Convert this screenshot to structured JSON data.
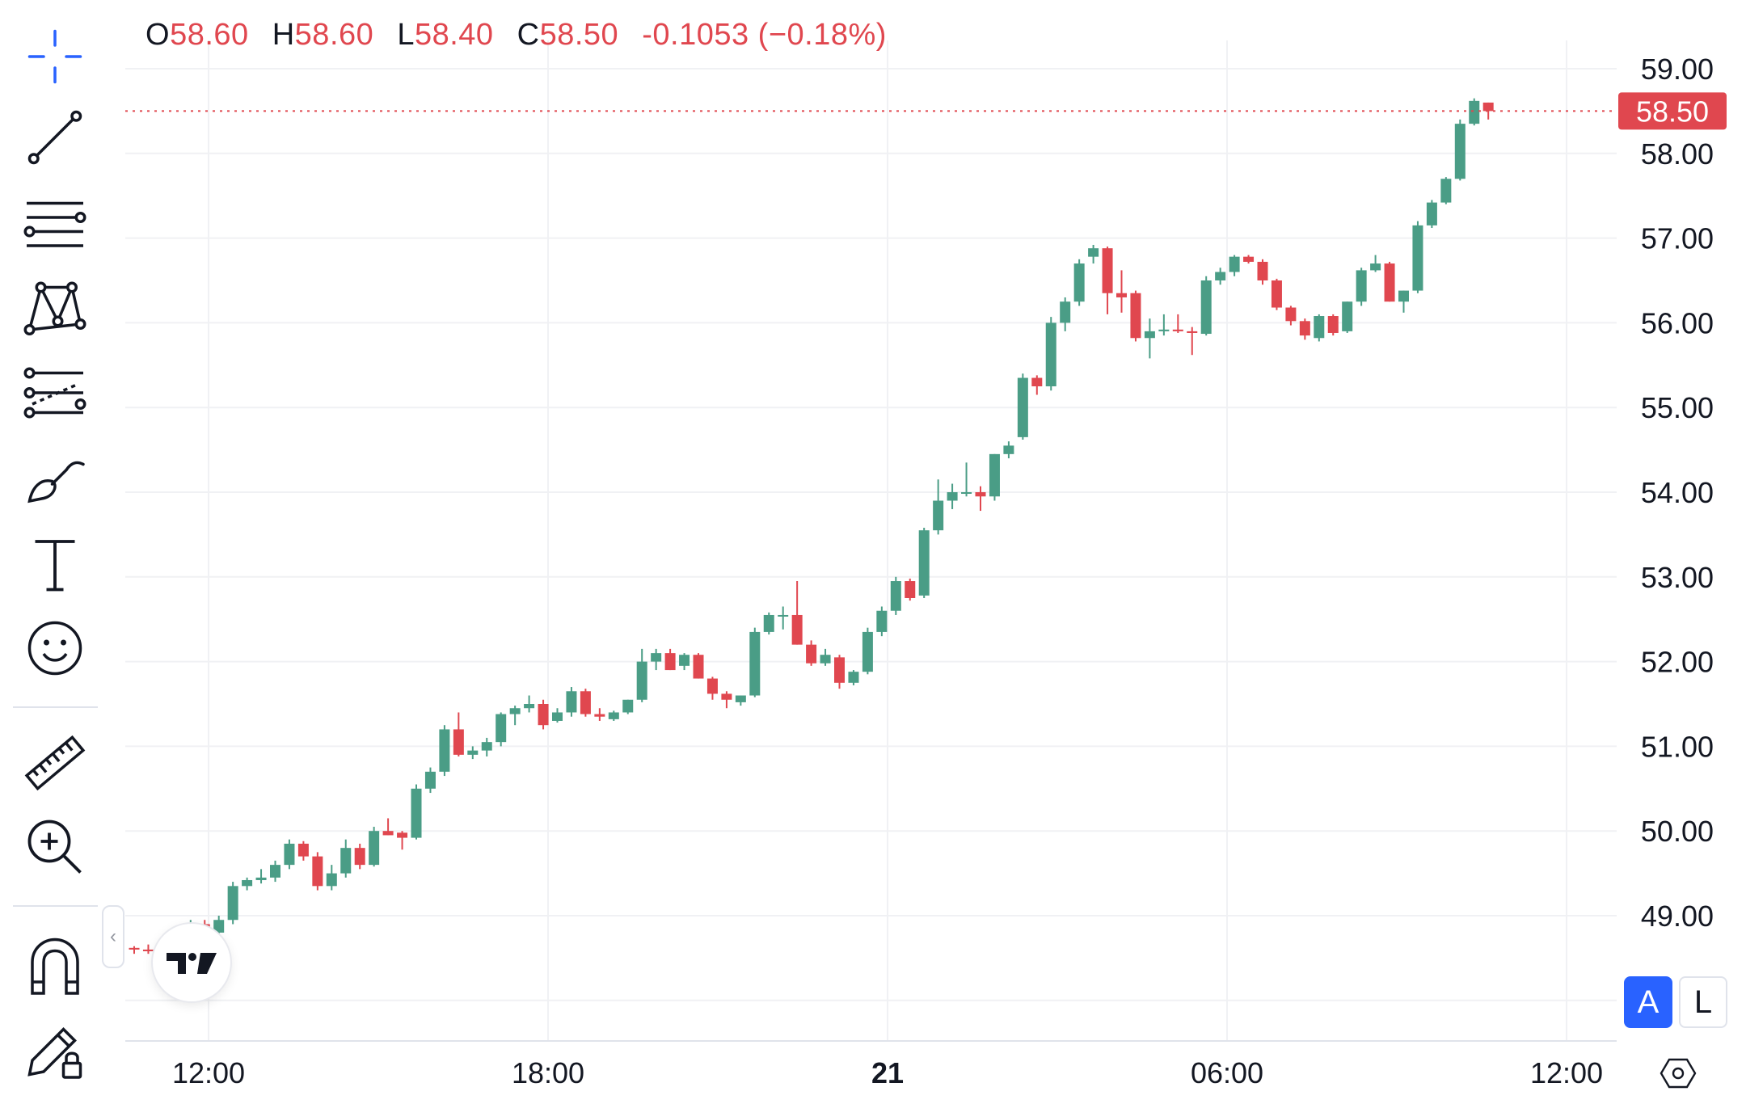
{
  "header": {
    "open_label": "O",
    "open": "58.60",
    "high_label": "H",
    "high": "58.60",
    "low_label": "L",
    "low": "58.40",
    "close_label": "C",
    "close": "58.50",
    "change": "-0.1053 (−0.18%)"
  },
  "toolbar": {
    "tools": [
      "crosshair-icon",
      "trend-line-icon",
      "horizontal-lines-icon",
      "pattern-icon",
      "projection-icon",
      "brush-icon",
      "text-icon",
      "emoji-icon",
      "ruler-icon",
      "zoom-in-icon",
      "magnet-icon",
      "lock-drawing-icon"
    ]
  },
  "price_scale": {
    "mode_auto": "A",
    "mode_log": "L"
  },
  "colors": {
    "up": "#4a9d86",
    "down": "#e0474f",
    "accent": "#2962ff",
    "grid": "#f0f1f4"
  },
  "chart_data": {
    "type": "candlestick",
    "y_ticks": [
      "49.00",
      "50.00",
      "51.00",
      "52.00",
      "53.00",
      "54.00",
      "55.00",
      "56.00",
      "57.00",
      "58.00",
      "59.00"
    ],
    "x_ticks": [
      {
        "label": "12:00",
        "bold": false
      },
      {
        "label": "18:00",
        "bold": false
      },
      {
        "label": "21",
        "bold": true
      },
      {
        "label": "06:00",
        "bold": false
      },
      {
        "label": "12:00",
        "bold": false
      }
    ],
    "last_price": "58.50",
    "ohlc": [
      [
        48.62,
        48.64,
        48.55,
        48.6
      ],
      [
        48.6,
        48.66,
        48.55,
        48.58
      ],
      [
        48.6,
        48.65,
        48.58,
        48.63
      ],
      [
        48.65,
        48.85,
        48.62,
        48.8
      ],
      [
        48.8,
        48.95,
        48.75,
        48.9
      ],
      [
        48.9,
        48.95,
        48.8,
        48.85
      ],
      [
        48.8,
        49.0,
        48.75,
        48.95
      ],
      [
        48.95,
        49.4,
        48.9,
        49.35
      ],
      [
        49.35,
        49.45,
        49.3,
        49.42
      ],
      [
        49.42,
        49.55,
        49.38,
        49.45
      ],
      [
        49.45,
        49.65,
        49.4,
        49.6
      ],
      [
        49.6,
        49.9,
        49.55,
        49.85
      ],
      [
        49.85,
        49.88,
        49.65,
        49.7
      ],
      [
        49.7,
        49.75,
        49.3,
        49.35
      ],
      [
        49.35,
        49.6,
        49.3,
        49.5
      ],
      [
        49.5,
        49.9,
        49.45,
        49.8
      ],
      [
        49.8,
        49.85,
        49.55,
        49.6
      ],
      [
        49.6,
        50.05,
        49.58,
        50.0
      ],
      [
        50.0,
        50.15,
        49.95,
        49.95
      ],
      [
        49.98,
        50.0,
        49.78,
        49.92
      ],
      [
        49.92,
        50.55,
        49.9,
        50.5
      ],
      [
        50.5,
        50.75,
        50.45,
        50.7
      ],
      [
        50.7,
        51.25,
        50.65,
        51.2
      ],
      [
        51.2,
        51.4,
        50.88,
        50.9
      ],
      [
        50.9,
        51.0,
        50.85,
        50.95
      ],
      [
        50.95,
        51.1,
        50.88,
        51.05
      ],
      [
        51.05,
        51.4,
        51.0,
        51.38
      ],
      [
        51.38,
        51.48,
        51.25,
        51.45
      ],
      [
        51.45,
        51.6,
        51.4,
        51.5
      ],
      [
        51.5,
        51.55,
        51.2,
        51.25
      ],
      [
        51.3,
        51.45,
        51.28,
        51.4
      ],
      [
        51.4,
        51.7,
        51.35,
        51.65
      ],
      [
        51.65,
        51.68,
        51.35,
        51.38
      ],
      [
        51.38,
        51.45,
        51.3,
        51.35
      ],
      [
        51.32,
        51.42,
        51.3,
        51.4
      ],
      [
        51.4,
        51.55,
        51.38,
        51.55
      ],
      [
        51.55,
        52.15,
        51.52,
        52.0
      ],
      [
        52.0,
        52.15,
        51.9,
        52.1
      ],
      [
        52.1,
        52.15,
        51.9,
        51.9
      ],
      [
        51.95,
        52.1,
        51.9,
        52.08
      ],
      [
        52.08,
        52.1,
        51.8,
        51.8
      ],
      [
        51.8,
        51.82,
        51.55,
        51.62
      ],
      [
        51.62,
        51.65,
        51.45,
        51.55
      ],
      [
        51.52,
        51.6,
        51.48,
        51.6
      ],
      [
        51.6,
        52.4,
        51.58,
        52.35
      ],
      [
        52.35,
        52.58,
        52.32,
        52.55
      ],
      [
        52.55,
        52.65,
        52.38,
        52.55
      ],
      [
        52.55,
        52.95,
        52.2,
        52.2
      ],
      [
        52.2,
        52.25,
        51.95,
        51.98
      ],
      [
        51.98,
        52.15,
        51.95,
        52.08
      ],
      [
        52.05,
        52.08,
        51.68,
        51.75
      ],
      [
        51.75,
        51.9,
        51.72,
        51.88
      ],
      [
        51.88,
        52.4,
        51.85,
        52.35
      ],
      [
        52.35,
        52.65,
        52.3,
        52.6
      ],
      [
        52.6,
        53.0,
        52.55,
        52.95
      ],
      [
        52.95,
        52.98,
        52.72,
        52.75
      ],
      [
        52.78,
        53.58,
        52.75,
        53.55
      ],
      [
        53.55,
        54.15,
        53.5,
        53.9
      ],
      [
        53.9,
        54.1,
        53.8,
        54.0
      ],
      [
        54.0,
        54.35,
        53.95,
        54.0
      ],
      [
        54.0,
        54.07,
        53.78,
        53.95
      ],
      [
        53.95,
        54.45,
        53.9,
        54.45
      ],
      [
        54.45,
        54.6,
        54.4,
        54.55
      ],
      [
        54.65,
        55.4,
        54.62,
        55.35
      ],
      [
        55.35,
        55.38,
        55.15,
        55.25
      ],
      [
        55.25,
        56.07,
        55.2,
        56.0
      ],
      [
        56.0,
        56.3,
        55.9,
        56.25
      ],
      [
        56.25,
        56.75,
        56.2,
        56.7
      ],
      [
        56.78,
        56.92,
        56.7,
        56.88
      ],
      [
        56.88,
        56.9,
        56.1,
        56.35
      ],
      [
        56.35,
        56.62,
        56.12,
        56.3
      ],
      [
        56.35,
        56.38,
        55.78,
        55.82
      ],
      [
        55.82,
        56.05,
        55.58,
        55.9
      ],
      [
        55.9,
        56.1,
        55.85,
        55.92
      ],
      [
        55.92,
        56.1,
        55.88,
        55.9
      ],
      [
        55.9,
        55.95,
        55.62,
        55.88
      ],
      [
        55.87,
        56.55,
        55.85,
        56.5
      ],
      [
        56.5,
        56.65,
        56.45,
        56.6
      ],
      [
        56.6,
        56.8,
        56.55,
        56.78
      ],
      [
        56.78,
        56.8,
        56.7,
        56.72
      ],
      [
        56.72,
        56.75,
        56.45,
        56.5
      ],
      [
        56.5,
        56.52,
        56.15,
        56.18
      ],
      [
        56.18,
        56.2,
        55.97,
        56.02
      ],
      [
        56.02,
        56.05,
        55.8,
        55.85
      ],
      [
        55.82,
        56.1,
        55.78,
        56.08
      ],
      [
        56.08,
        56.1,
        55.85,
        55.88
      ],
      [
        55.9,
        56.25,
        55.88,
        56.25
      ],
      [
        56.25,
        56.65,
        56.2,
        56.62
      ],
      [
        56.62,
        56.8,
        56.6,
        56.7
      ],
      [
        56.7,
        56.72,
        56.25,
        56.25
      ],
      [
        56.25,
        56.38,
        56.12,
        56.38
      ],
      [
        56.38,
        57.2,
        56.35,
        57.15
      ],
      [
        57.15,
        57.45,
        57.12,
        57.42
      ],
      [
        57.42,
        57.72,
        57.4,
        57.7
      ],
      [
        57.7,
        58.4,
        57.68,
        58.35
      ],
      [
        58.35,
        58.65,
        58.33,
        58.62
      ],
      [
        58.6,
        58.6,
        58.4,
        58.5
      ]
    ]
  }
}
